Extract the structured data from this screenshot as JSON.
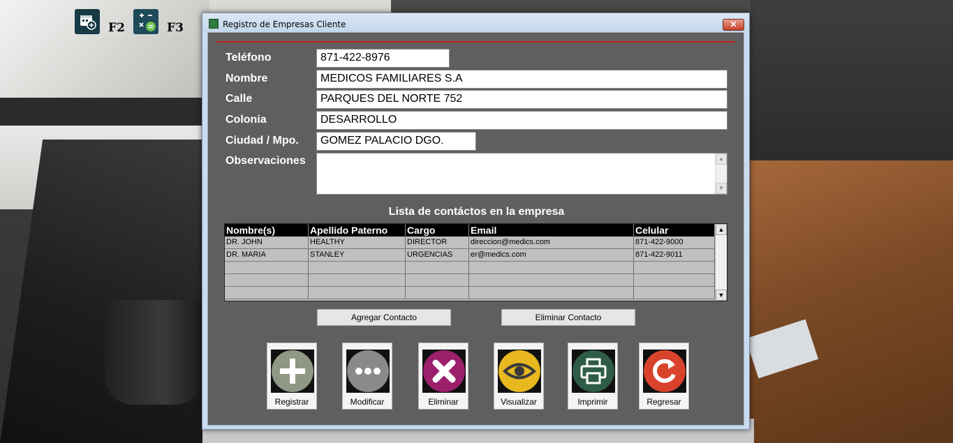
{
  "desktop": {
    "shortcuts": [
      {
        "key_label": "F2",
        "icon": "calendar-add-icon"
      },
      {
        "key_label": "F3",
        "icon": "calculator-icon"
      }
    ]
  },
  "window": {
    "title": "Registro de Empresas Cliente",
    "close_label": "✕"
  },
  "form": {
    "telefono": {
      "label": "Teléfono",
      "value": "871-422-8976"
    },
    "nombre": {
      "label": "Nombre",
      "value": "MEDICOS FAMILIARES S.A"
    },
    "calle": {
      "label": "Calle",
      "value": "PARQUES DEL NORTE 752"
    },
    "colonia": {
      "label": "Colonia",
      "value": "DESARROLLO"
    },
    "ciudad": {
      "label": "Ciudad / Mpo.",
      "value": "GOMEZ PALACIO DGO."
    },
    "observaciones": {
      "label": "Observaciones",
      "value": ""
    }
  },
  "contacts": {
    "title": "Lista de contáctos en la empresa",
    "columns": [
      "Nombre(s)",
      "Apellido Paterno",
      "Cargo",
      "Email",
      "Celular"
    ],
    "rows": [
      [
        "DR. JOHN",
        "HEALTHY",
        "DIRECTOR",
        "direccion@medics.com",
        "871-422-9000"
      ],
      [
        "DR. MARIA",
        "STANLEY",
        "URGENCIAS",
        "er@medics.com",
        "871-422-9011"
      ],
      [
        "",
        "",
        "",
        "",
        ""
      ],
      [
        "",
        "",
        "",
        "",
        ""
      ],
      [
        "",
        "",
        "",
        "",
        ""
      ]
    ],
    "add_label": "Agregar  Contacto",
    "delete_label": "Eliminar  Contacto"
  },
  "actions": [
    {
      "label": "Registrar",
      "icon": "plus-icon",
      "color": "#8f9785"
    },
    {
      "label": "Modificar",
      "icon": "more-icon",
      "color": "#8a8a8a"
    },
    {
      "label": "Eliminar",
      "icon": "cross-icon",
      "color": "#9b1f6b"
    },
    {
      "label": "Visualizar",
      "icon": "eye-icon",
      "color": "#e8b820"
    },
    {
      "label": "Imprimir",
      "icon": "printer-icon",
      "color": "#2f5c47"
    },
    {
      "label": "Regresar",
      "icon": "redo-icon",
      "color": "#d9432c"
    }
  ]
}
